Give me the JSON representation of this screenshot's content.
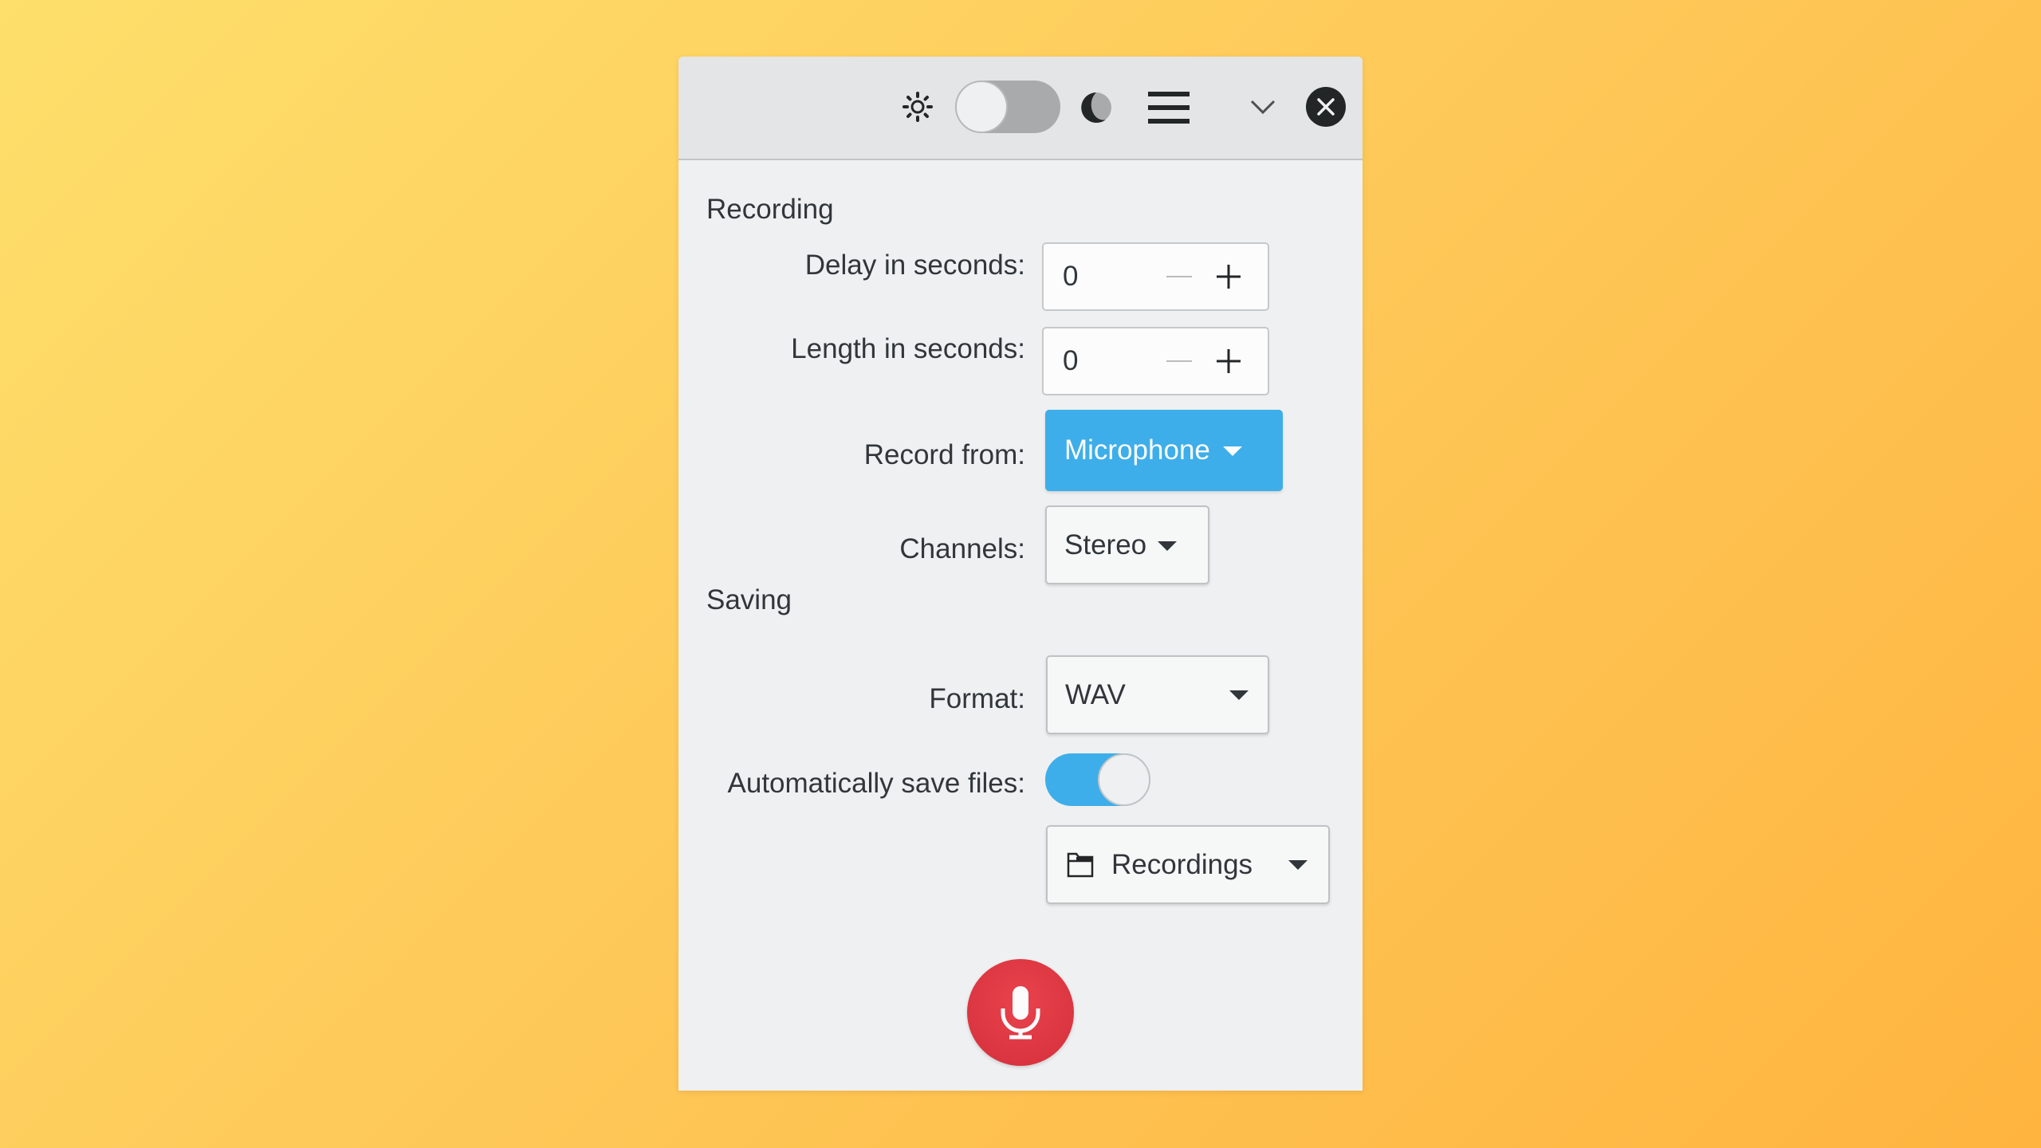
{
  "header": {
    "icons": {
      "light_theme": "sun-icon",
      "dark_theme": "moon-half-icon",
      "menu": "hamburger-menu-icon",
      "minimize": "chevron-down-icon",
      "close": "close-circle-icon"
    },
    "theme_toggle": {
      "dark_mode_enabled": false
    }
  },
  "recording": {
    "title": "Recording",
    "delay": {
      "label": "Delay in seconds:",
      "value": "0"
    },
    "length": {
      "label": "Length in seconds:",
      "value": "0"
    },
    "record_from": {
      "label": "Record from:",
      "value": "Microphone"
    },
    "channels": {
      "label": "Channels:",
      "value": "Stereo"
    }
  },
  "saving": {
    "title": "Saving",
    "format": {
      "label": "Format:",
      "value": "WAV"
    },
    "auto_save": {
      "label": "Automatically save files:",
      "enabled": true
    },
    "folder": {
      "value": "Recordings",
      "icon": "folder-icon"
    }
  },
  "record_button": {
    "icon": "microphone-icon"
  },
  "colors": {
    "accent": "#3daee9",
    "record": "#da3540",
    "window_bg": "#eff0f1",
    "header_bg": "#e3e5e7",
    "text": "#31363b",
    "background_start": "#fedf6b",
    "background_end": "#ffb43f"
  }
}
